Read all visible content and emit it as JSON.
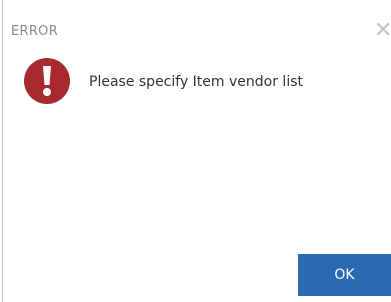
{
  "dialog": {
    "title": "ERROR",
    "close_icon": "close-icon",
    "status_icon": "error-exclamation-icon",
    "message": "Please specify Item vendor list",
    "ok_label": "OK"
  },
  "colors": {
    "error_red": "#a82a2e",
    "button_blue": "#2b6ab0",
    "title_gray": "#8a8a8a"
  }
}
